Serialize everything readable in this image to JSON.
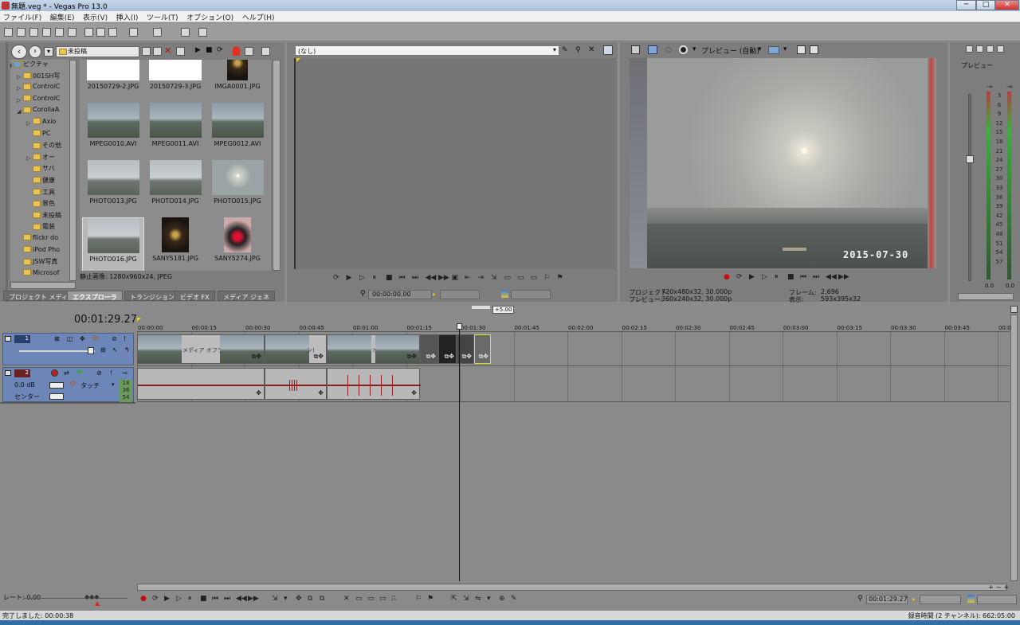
{
  "window": {
    "title": "無題.veg * - Vegas Pro 13.0",
    "minimize": "─",
    "maximize": "□",
    "close": "✕"
  },
  "menu": [
    "ファイル(F)",
    "編集(E)",
    "表示(V)",
    "挿入(I)",
    "ツール(T)",
    "オプション(O)",
    "ヘルプ(H)"
  ],
  "explorer": {
    "path": "未投稿",
    "tree": [
      {
        "label": "ピクチャ",
        "indent": 0
      },
      {
        "label": "001SH写",
        "indent": 1
      },
      {
        "label": "ControlC",
        "indent": 1
      },
      {
        "label": "ControlC",
        "indent": 1
      },
      {
        "label": "CorollaA",
        "indent": 1
      },
      {
        "label": "Axio",
        "indent": 2
      },
      {
        "label": "PC",
        "indent": 2
      },
      {
        "label": "その他",
        "indent": 2
      },
      {
        "label": "オー",
        "indent": 2
      },
      {
        "label": "サバ",
        "indent": 2
      },
      {
        "label": "健康",
        "indent": 2
      },
      {
        "label": "工具",
        "indent": 2
      },
      {
        "label": "景色",
        "indent": 2
      },
      {
        "label": "未投稿",
        "indent": 2
      },
      {
        "label": "電装",
        "indent": 2
      },
      {
        "label": "flickr do",
        "indent": 1
      },
      {
        "label": "iPod Pho",
        "indent": 1
      },
      {
        "label": "JSW写真",
        "indent": 1
      },
      {
        "label": "Microsof",
        "indent": 1
      }
    ],
    "files": [
      {
        "name": "20150729-2.JPG",
        "scene": "blue"
      },
      {
        "name": "20150729-3.JPG",
        "scene": "blue"
      },
      {
        "name": "IMGA0001.JPG",
        "scene": "dark"
      },
      {
        "name": "MPEG0010.AVI",
        "scene": "gray"
      },
      {
        "name": "MPEG0011.AVI",
        "scene": "gray"
      },
      {
        "name": "MPEG0012.AVI",
        "scene": "gray"
      },
      {
        "name": "PHOTO013.JPG",
        "scene": "fog"
      },
      {
        "name": "PHOTO014.JPG",
        "scene": "fog"
      },
      {
        "name": "PHOTO015.JPG",
        "scene": "sun"
      },
      {
        "name": "PHOTO016.JPG",
        "scene": "fog"
      },
      {
        "name": "SANY5181.JPG",
        "scene": "dark"
      },
      {
        "name": "SANY5274.JPG",
        "scene": "red"
      }
    ],
    "status": "静止画像: 1280x960x24, JPEG",
    "tabs": [
      "プロジェクト メディア",
      "エクスプローラ",
      "トランジション",
      "ビデオ FX",
      "メディア ジェネ"
    ]
  },
  "trimmer": {
    "dropdown": "(なし)",
    "time": "00:00:00.00"
  },
  "preview": {
    "mode": "プレビュー (自動)",
    "timestamp": "2015-07-30",
    "project_label": "プロジェクト:",
    "project_value": "720x480x32, 30.000p",
    "preview_label": "プレビュー:",
    "preview_value": "360x240x32, 30.000p",
    "frame_label": "フレーム:",
    "frame_value": "2,696",
    "display_label": "表示:",
    "display_value": "593x395x32"
  },
  "meter": {
    "title": "プレビュー",
    "inf": "-∞",
    "scale": [
      "3",
      "6",
      "9",
      "12",
      "15",
      "18",
      "21",
      "24",
      "27",
      "30",
      "33",
      "36",
      "39",
      "42",
      "45",
      "48",
      "51",
      "54",
      "57"
    ],
    "bottom": [
      "0.0",
      "0.0"
    ]
  },
  "timeline": {
    "current_time": "00:01:29.27",
    "zoom_label": "+5.00",
    "ruler": [
      "00:00:00",
      "00:00:15",
      "00:00:30",
      "00:00:45",
      "00:01:00",
      "00:01:15",
      "00:01:30",
      "00:01:45",
      "00:02:00",
      "00:02:15",
      "00:02:30",
      "00:02:45",
      "00:03:00",
      "00:03:15",
      "00:03:30",
      "00:03:45",
      "00:0"
    ],
    "video_track": {
      "number": "1"
    },
    "audio_track": {
      "number": "2",
      "volume": "0.0 dB",
      "mode": "タッチ",
      "pan": "センター",
      "scale": [
        "18",
        "36",
        "54"
      ]
    },
    "clip_texts": [
      "メディア オフライン",
      "ン)",
      "オ"
    ],
    "rate": "レート: 0.00",
    "bottom_time": "00:01:29.27"
  },
  "statusbar": {
    "left": "完了しました: 00:00:38",
    "right": "録音時間 (2 チャンネル): 662:05:00"
  }
}
